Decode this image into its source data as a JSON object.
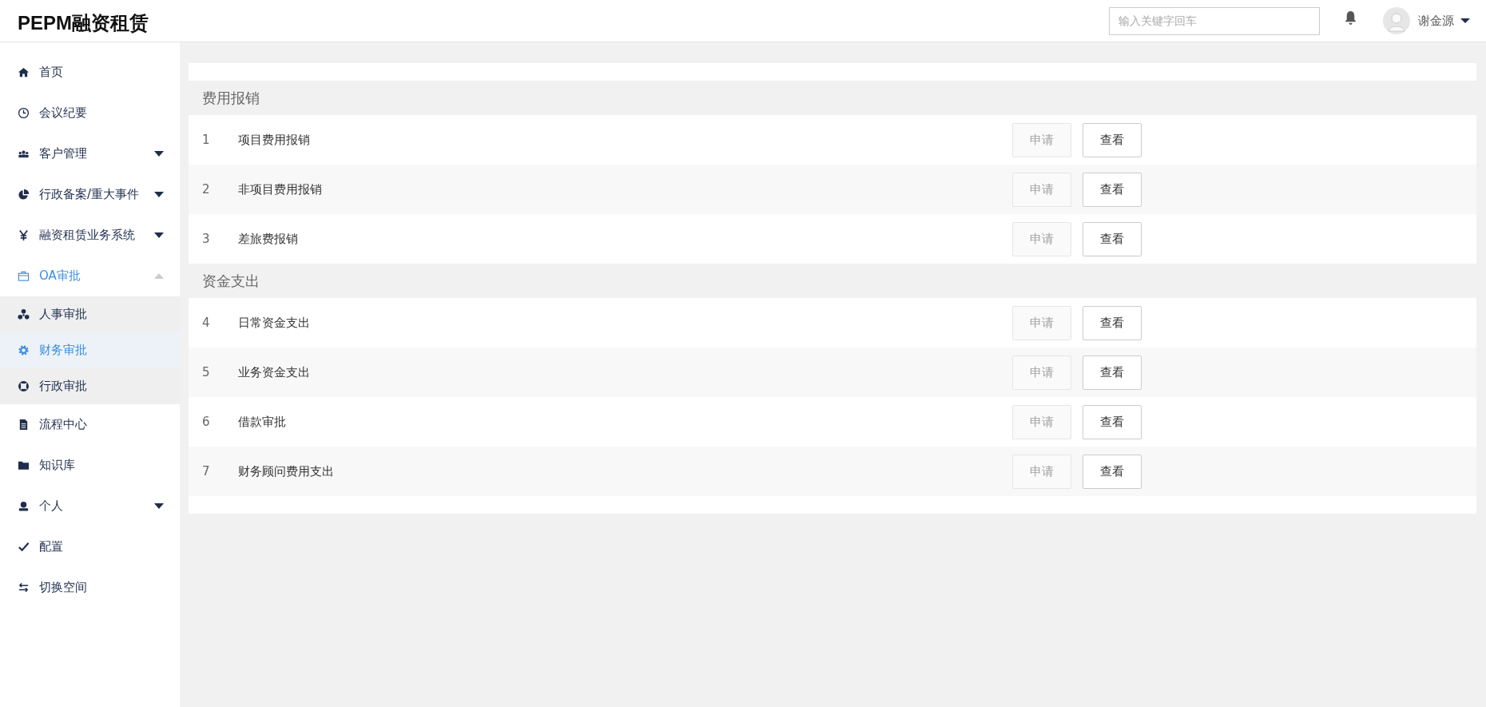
{
  "header": {
    "logo": "PEPM融资租赁",
    "search": {
      "placeholder": "输入关键字回车"
    },
    "user": {
      "name": "谢金源"
    }
  },
  "sidebar": {
    "items": [
      {
        "label": "首页"
      },
      {
        "label": "会议纪要"
      },
      {
        "label": "客户管理",
        "expanded": false
      },
      {
        "label": "行政备案/重大事件",
        "expanded": false
      },
      {
        "label": "融资租赁业务系统",
        "expanded": false
      },
      {
        "label": "OA审批",
        "expanded": true,
        "children": [
          {
            "label": "人事审批",
            "selected": false
          },
          {
            "label": "财务审批",
            "selected": true
          },
          {
            "label": "行政审批",
            "selected": false
          }
        ]
      },
      {
        "label": "流程中心"
      },
      {
        "label": "知识库"
      },
      {
        "label": "个人",
        "expanded": false
      },
      {
        "label": "配置"
      },
      {
        "label": "切换空间"
      }
    ]
  },
  "sections": [
    {
      "title": "费用报销",
      "rows": [
        {
          "index": "1",
          "name": "项目费用报销",
          "apply": {
            "label": "申请",
            "disabled": true
          },
          "view": {
            "label": "查看"
          }
        },
        {
          "index": "2",
          "name": "非项目费用报销",
          "apply": {
            "label": "申请",
            "disabled": true
          },
          "view": {
            "label": "查看"
          }
        },
        {
          "index": "3",
          "name": "差旅费报销",
          "apply": {
            "label": "申请",
            "disabled": true
          },
          "view": {
            "label": "查看"
          }
        }
      ]
    },
    {
      "title": "资金支出",
      "rows": [
        {
          "index": "4",
          "name": "日常资金支出",
          "apply": {
            "label": "申请",
            "disabled": true
          },
          "view": {
            "label": "查看"
          }
        },
        {
          "index": "5",
          "name": "业务资金支出",
          "apply": {
            "label": "申请",
            "disabled": true
          },
          "view": {
            "label": "查看"
          }
        },
        {
          "index": "6",
          "name": "借款审批",
          "apply": {
            "label": "申请",
            "disabled": true
          },
          "view": {
            "label": "查看"
          }
        },
        {
          "index": "7",
          "name": "财务顾问费用支出",
          "apply": {
            "label": "申请",
            "disabled": true
          },
          "view": {
            "label": "查看"
          }
        }
      ]
    }
  ]
}
